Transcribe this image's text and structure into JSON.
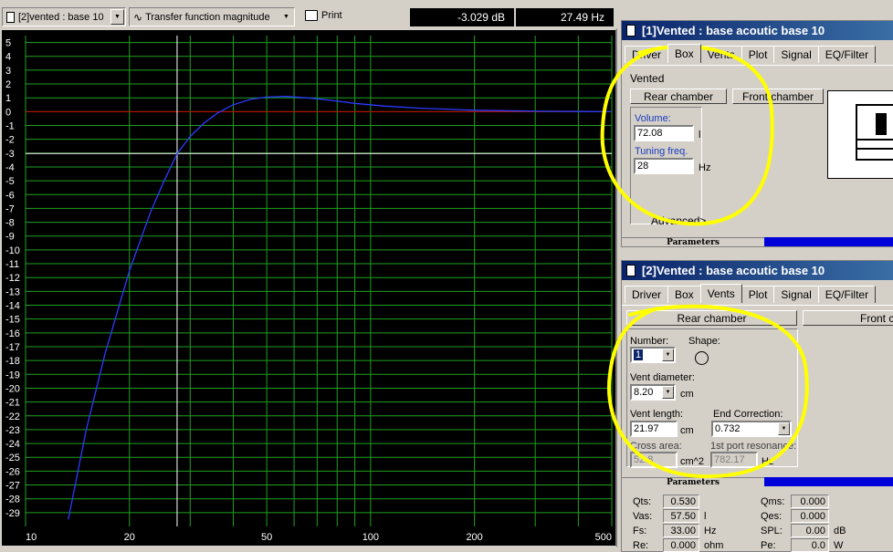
{
  "toolbar": {
    "project_select": "[2]vented : base 10",
    "graph_type": "Transfer function magnitude",
    "print_label": "Print",
    "readout_db": "-3.029 dB",
    "readout_hz": "27.49 Hz"
  },
  "chart_data": {
    "type": "line",
    "xscale": "log",
    "xlim": [
      10,
      500
    ],
    "ylim": [
      -30,
      5.5
    ],
    "x_ticks": [
      "10",
      "20",
      "50",
      "100",
      "200",
      "500"
    ],
    "y_ticks": [
      "5",
      "4",
      "3",
      "2",
      "1",
      "0",
      "-1",
      "-2",
      "-3",
      "-4",
      "-5",
      "-6",
      "-7",
      "-8",
      "-9",
      "-10",
      "-11",
      "-12",
      "-13",
      "-14",
      "-15",
      "-16",
      "-17",
      "-18",
      "-19",
      "-20",
      "-21",
      "-22",
      "-23",
      "-24",
      "-25",
      "-26",
      "-27",
      "-28",
      "-29"
    ],
    "series": [
      {
        "x": [
          13.3,
          15,
          17,
          20,
          23,
          25,
          27.5,
          30,
          33,
          36,
          40,
          45,
          50,
          57,
          65,
          75,
          90,
          110,
          140,
          200,
          300,
          500
        ],
        "y": [
          -29.5,
          -23,
          -17.5,
          -11.5,
          -7.3,
          -5.2,
          -3.03,
          -1.8,
          -0.8,
          -0.1,
          0.5,
          0.9,
          1.05,
          1.1,
          1.0,
          0.85,
          0.6,
          0.4,
          0.25,
          0.1,
          0.03,
          0.0
        ],
        "color": "#2a3cff"
      }
    ],
    "reference_lines": {
      "zero_db_color": "#cc0000",
      "minus3_db": -3.029,
      "cursor_hz": 27.49
    },
    "grid": true
  },
  "win1": {
    "title": "[1]Vented : base acoutic  base 10",
    "tabs": [
      "Driver",
      "Box",
      "Vents",
      "Plot",
      "Signal",
      "EQ/Filter"
    ],
    "box_type": "Vented",
    "rear_chamber": "Rear chamber",
    "front_chamber": "Front chamber",
    "volume_label": "Volume:",
    "volume_value": "72.08",
    "volume_unit": "l",
    "tuning_label": "Tuning freq.",
    "tuning_value": "28",
    "tuning_unit": "Hz",
    "advanced": "Advanced>",
    "parameters": "Parameters"
  },
  "win2": {
    "title": "[2]Vented : base acoutic  base 10",
    "tabs": [
      "Driver",
      "Box",
      "Vents",
      "Plot",
      "Signal",
      "EQ/Filter"
    ],
    "rear_chamber": "Rear chamber",
    "front_chamber": "Front ch",
    "number_label": "Number:",
    "number_value": "1",
    "shape_label": "Shape:",
    "vent_diameter_label": "Vent diameter:",
    "vent_diameter_value": "8.20",
    "vent_diameter_unit": "cm",
    "vent_length_label": "Vent length:",
    "vent_length_value": "21.97",
    "vent_length_unit": "cm",
    "end_correction_label": "End Correction:",
    "end_correction_value": "0.732",
    "cross_area_label": "Cross area:",
    "cross_area_value": "52.8",
    "cross_area_unit": "cm^2",
    "port_res_label": "1st port resonance:",
    "port_res_value": "782.17",
    "port_res_unit": "Hz",
    "parameters": "Parameters",
    "params": {
      "qts_label": "Qts:",
      "qts": "0.530",
      "vas_label": "Vas:",
      "vas": "57.50",
      "vas_unit": "l",
      "fs_label": "Fs:",
      "fs": "33.00",
      "fs_unit": "Hz",
      "re_label": "Re:",
      "re": "0.000",
      "re_unit": "ohm",
      "qms_label": "Qms:",
      "qms": "0.000",
      "qes_label": "Qes:",
      "qes": "0.000",
      "spl_label": "SPL:",
      "spl": "0.00",
      "spl_unit": "dB",
      "pe_label": "Pe:",
      "pe": "0.0",
      "pe_unit": "W"
    }
  },
  "annotation_color": "#ffff00"
}
